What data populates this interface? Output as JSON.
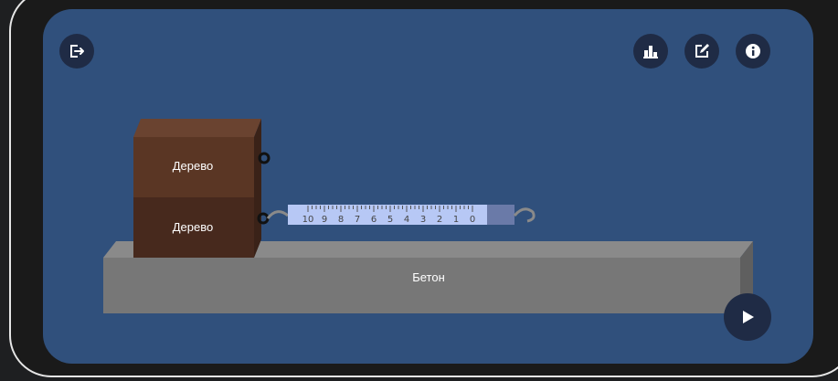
{
  "toolbar": {
    "exit_icon": "exit-icon",
    "chart_icon": "bar-chart-icon",
    "edit_icon": "edit-icon",
    "info_icon": "info-icon"
  },
  "scene": {
    "block_top_label": "Дерево",
    "block_bottom_label": "Дерево",
    "surface_label": "Бетон",
    "dynamometer": {
      "scale_labels": [
        "10",
        "9",
        "8",
        "7",
        "6",
        "5",
        "4",
        "3",
        "2",
        "1",
        "0"
      ]
    }
  },
  "controls": {
    "play_icon": "play-icon"
  },
  "colors": {
    "screen_bg": "#30507c",
    "button_bg": "#1f2b45",
    "wood_top": "#5a3624",
    "wood_bottom": "#47291d",
    "concrete": "#777777",
    "dynamometer_scale": "#b7c8f5"
  }
}
